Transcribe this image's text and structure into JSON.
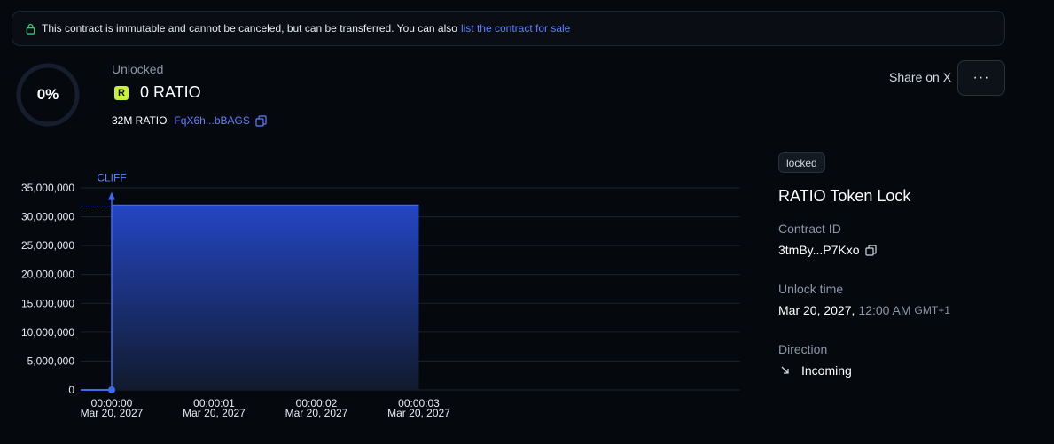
{
  "banner": {
    "text": "This contract is immutable and cannot be canceled, but can be transferred. You can also",
    "link": "list the contract for sale",
    "icon": "lock-icon"
  },
  "progress": {
    "percent_label": "0%",
    "fraction": 0
  },
  "summary": {
    "unlocked_label": "Unlocked",
    "token_letter": "R",
    "amount": "0 RATIO",
    "total": "32M RATIO",
    "mint_address": "FqX6h...bBAGS"
  },
  "actions": {
    "share": "Share on X",
    "more": "···"
  },
  "details": {
    "status": "locked",
    "title": "RATIO Token Lock",
    "contract_id_label": "Contract ID",
    "contract_id": "3tmBy...P7Kxo",
    "unlock_time_label": "Unlock time",
    "unlock_date": "Mar 20, 2027,",
    "unlock_clock": "12:00 AM",
    "unlock_tz": "GMT+1",
    "direction_label": "Direction",
    "direction": "Incoming"
  },
  "colors": {
    "accent": "#3d6af5",
    "link": "#5b82ff",
    "token": "#c8f135",
    "background": "#05080d"
  },
  "chart_data": {
    "type": "area",
    "annotation": "CLIFF",
    "y_ticks": [
      "35,000,000",
      "30,000,000",
      "25,000,000",
      "20,000,000",
      "15,000,000",
      "10,000,000",
      "5,000,000",
      "0"
    ],
    "ylim": [
      0,
      35000000
    ],
    "x_ticks": [
      {
        "time": "00:00:00",
        "date": "Mar 20, 2027"
      },
      {
        "time": "00:00:01",
        "date": "Mar 20, 2027"
      },
      {
        "time": "00:00:02",
        "date": "Mar 20, 2027"
      },
      {
        "time": "00:00:03",
        "date": "Mar 20, 2027"
      }
    ],
    "series": [
      {
        "x": [
          -0.3,
          0,
          0,
          3
        ],
        "y": [
          0,
          0,
          32000000,
          32000000
        ]
      }
    ],
    "grid": true
  }
}
